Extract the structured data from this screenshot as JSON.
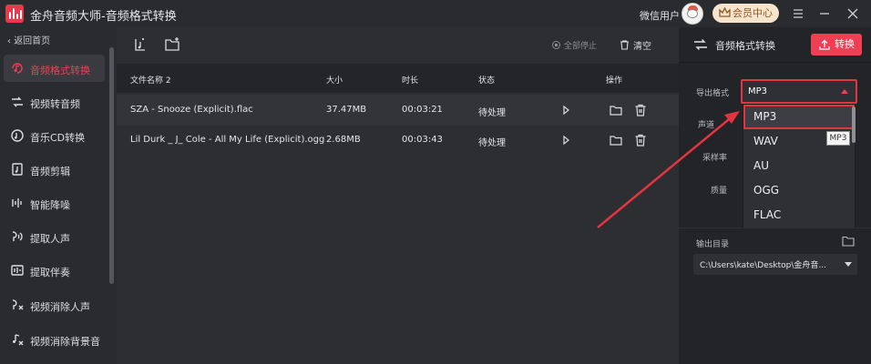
{
  "window": {
    "title": "金舟音频大师-音频格式转换",
    "user_name": "微信用户",
    "vip_label": "会员中心"
  },
  "sidebar": {
    "back_label": "返回首页",
    "items": [
      {
        "label": "音频格式转换",
        "icon": "music-convert-icon",
        "active": true
      },
      {
        "label": "视频转音频",
        "icon": "video-to-audio-icon"
      },
      {
        "label": "音乐CD转换",
        "icon": "cd-icon"
      },
      {
        "label": "音频剪辑",
        "icon": "audio-cut-icon"
      },
      {
        "label": "智能降噪",
        "icon": "noise-reduction-icon"
      },
      {
        "label": "提取人声",
        "icon": "extract-vocal-icon"
      },
      {
        "label": "提取伴奏",
        "icon": "extract-accompaniment-icon"
      },
      {
        "label": "视频消除人声",
        "icon": "video-remove-vocal-icon"
      },
      {
        "label": "视频消除背景音",
        "icon": "video-remove-bg-icon"
      }
    ]
  },
  "toolbar": {
    "stop_all_label": "全部停止",
    "clear_label": "清空"
  },
  "table": {
    "headers": {
      "name": "文件名称 2",
      "size": "大小",
      "duration": "时长",
      "status": "状态",
      "actions": "操作"
    },
    "rows": [
      {
        "name": "SZA - Snooze (Explicit).flac",
        "size": "37.47MB",
        "duration": "00:03:21",
        "status": "待处理"
      },
      {
        "name": "Lil Durk _ J_ Cole - All My Life (Explicit).ogg",
        "size": "2.68MB",
        "duration": "00:03:43",
        "status": "待处理"
      }
    ]
  },
  "panel": {
    "title": "音频格式转换",
    "convert_label": "转换",
    "export_format_label": "导出格式",
    "export_format_value": "MP3",
    "channel_label": "声道",
    "sample_rate_label": "采样率",
    "quality_label": "质量",
    "format_options": [
      "MP3",
      "WAV",
      "AU",
      "OGG",
      "FLAC"
    ],
    "tooltip": "MP3",
    "output_dir_label": "输出目录",
    "output_dir_value": "C:\\Users\\kate\\Desktop\\金舟音..."
  },
  "colors": {
    "accent": "#ef3f55",
    "annotation": "#e23540",
    "background": "#2d2e32",
    "panel": "#232428"
  }
}
